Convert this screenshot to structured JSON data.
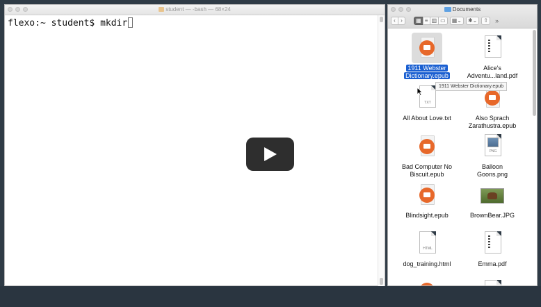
{
  "terminal": {
    "title": "student — -bash — 68×24",
    "prompt": "flexo:~ student$ ",
    "command": "mkdir"
  },
  "video": {
    "play_icon": "play-icon"
  },
  "finder": {
    "title": "Documents",
    "toolbar": {
      "back": "‹",
      "forward": "›",
      "view_icons": "▦",
      "view_list": "≡",
      "view_columns": "▥",
      "view_gallery": "▭",
      "arrange": "▦⌄",
      "action": "✱⌄",
      "share": "⇧",
      "more": "»"
    },
    "tooltip": "1911 Webster Dictionary.epub",
    "files": [
      {
        "name": "1911 Webster\nDictionary.epub",
        "line1": "1911 Webster",
        "line2": "Dictionary.epub",
        "kind": "epub",
        "selected": true
      },
      {
        "name": "Alice's Adventu...land.pdf",
        "line1": "Alice's",
        "line2": "Adventu...land.pdf",
        "kind": "pdf"
      },
      {
        "name": "All About Love.txt",
        "line1": "All About Love.txt",
        "line2": "",
        "kind": "txt",
        "tag": "TXT"
      },
      {
        "name": "Also Sprach Zarathustra.epub",
        "line1": "Also Sprach",
        "line2": "Zarathustra.epub",
        "kind": "epub"
      },
      {
        "name": "Bad Computer No Biscuit.epub",
        "line1": "Bad Computer No",
        "line2": "Biscuit.epub",
        "kind": "epub"
      },
      {
        "name": "Balloon Goons.png",
        "line1": "Balloon",
        "line2": "Goons.png",
        "kind": "png",
        "tag": "PNG"
      },
      {
        "name": "Blindsight.epub",
        "line1": "Blindsight.epub",
        "line2": "",
        "kind": "epub"
      },
      {
        "name": "BrownBear.JPG",
        "line1": "BrownBear.JPG",
        "line2": "",
        "kind": "jpg"
      },
      {
        "name": "dog_training.html",
        "line1": "dog_training.html",
        "line2": "",
        "kind": "html",
        "tag": "HTML"
      },
      {
        "name": "Emma.pdf",
        "line1": "Emma.pdf",
        "line2": "",
        "kind": "pdf"
      }
    ]
  }
}
